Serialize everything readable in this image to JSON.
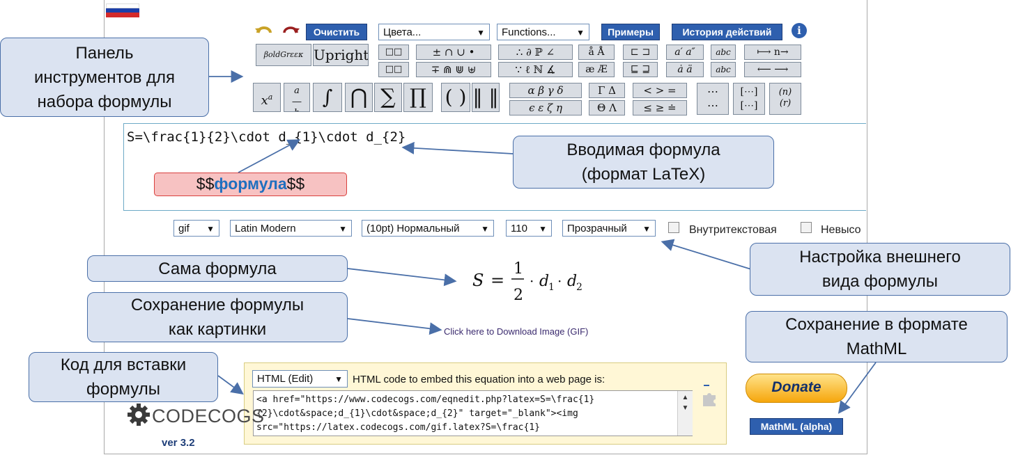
{
  "toolbar": {
    "clear_label": "Очистить",
    "colors_select": "Цвета...",
    "functions_select": "Functions...",
    "examples_label": "Примеры",
    "history_label": "История действий",
    "info_icon": "i",
    "bold_greek": "βoldGrεεκ",
    "upright": "Upright"
  },
  "editor": {
    "latex_value": "S=\\frac{1}{2}\\cdot d_{1}\\cdot d_{2}",
    "red_prefix": "$$",
    "red_word": "формула",
    "red_suffix": "$$"
  },
  "options": {
    "format": "gif",
    "font": "Latin Modern",
    "size": "(10pt) Нормальный",
    "dpi": "110",
    "background": "Прозрачный",
    "inline_label": "Внутритекстовая",
    "cut_label": "Невысо"
  },
  "preview": {
    "download_link": "Click here to Download Image (GIF)"
  },
  "embed": {
    "mode_select": "HTML (Edit)",
    "caption": "HTML code to embed this equation into a web page is:",
    "code_lines": [
      "<a href=\"https://www.codecogs.com/eqnedit.php?latex=S=\\frac{1}",
      "{2}\\cdot&space;d_{1}\\cdot&space;d_{2}\" target=\"_blank\"><img",
      "src=\"https://latex.codecogs.com/gif.latex?S=\\frac{1}"
    ]
  },
  "branding": {
    "logo_text": "CODECOGS",
    "version": "ver 3.2",
    "donate_label": "Donate",
    "mathml_label": "MathML (alpha)"
  },
  "callouts": {
    "toolbar": [
      "Панель",
      "инструментов для",
      "набора формулы"
    ],
    "formula_input": [
      "Вводимая формула",
      "(формат LaTeX)"
    ],
    "formula_itself": "Сама формула",
    "appearance": [
      "Настройка внешнего",
      "вида формулы"
    ],
    "save_image": [
      "Сохранение формулы",
      "как картинки"
    ],
    "save_mathml": [
      "Сохранение в формате",
      "MathML"
    ],
    "embed_code": [
      "Код для вставки",
      "формулы"
    ]
  },
  "colors": {
    "button_blue": "#2e5fae",
    "callout_fill": "#dbe3f1",
    "callout_border": "#4a6fa8",
    "red_box": "#f7c2c2"
  }
}
